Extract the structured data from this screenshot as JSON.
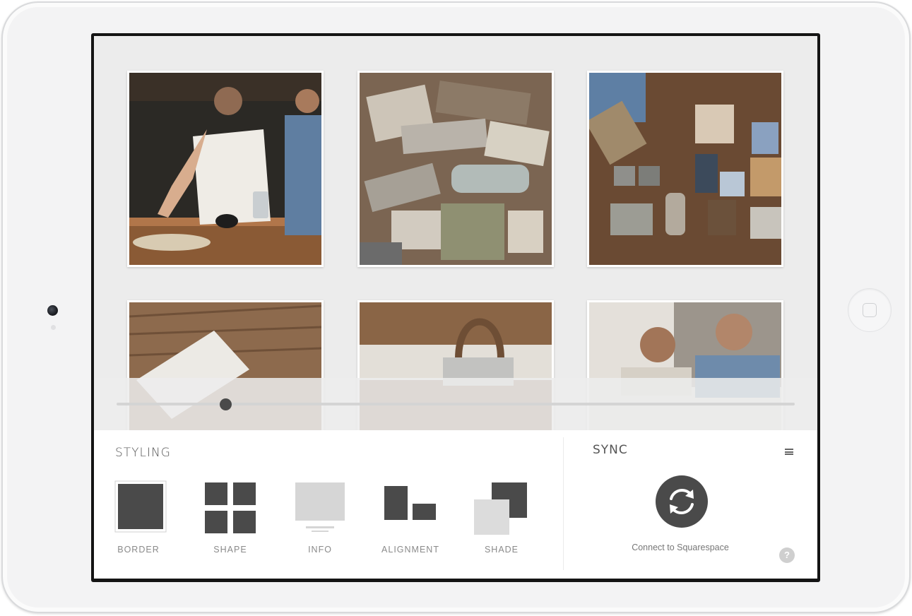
{
  "styling": {
    "title": "STYLING",
    "options": [
      {
        "label": "BORDER",
        "icon": "border-icon",
        "selected": true
      },
      {
        "label": "SHAPE",
        "icon": "shape-grid-icon",
        "selected": false
      },
      {
        "label": "INFO",
        "icon": "info-display-icon",
        "selected": false
      },
      {
        "label": "ALIGNMENT",
        "icon": "alignment-icon",
        "selected": false
      },
      {
        "label": "SHADE",
        "icon": "shade-icon",
        "selected": false
      }
    ]
  },
  "sync": {
    "title": "SYNC",
    "connect_label": "Connect to Squarespace",
    "help_label": "?"
  },
  "gallery": {
    "photos": [
      {
        "subject": "two men at workbench",
        "icon": "photo-thumbnail"
      },
      {
        "subject": "material samples on wood table",
        "icon": "photo-thumbnail"
      },
      {
        "subject": "tile samples flat lay",
        "icon": "photo-thumbnail"
      },
      {
        "subject": "blueprint on wood floor",
        "icon": "photo-thumbnail"
      },
      {
        "subject": "glass jar with rope handle",
        "icon": "photo-thumbnail"
      },
      {
        "subject": "portrait of two men",
        "icon": "photo-thumbnail"
      }
    ]
  },
  "slider": {
    "value_fraction": 0.16
  },
  "colors": {
    "accent": "#4a4a4a",
    "panel_bg": "#ffffff",
    "canvas_bg": "#ececec"
  }
}
